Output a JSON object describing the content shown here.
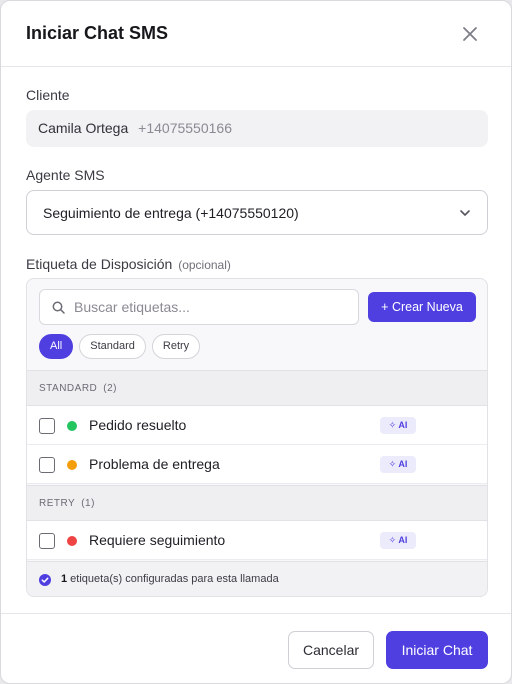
{
  "dialog": {
    "title": "Iniciar Chat SMS"
  },
  "client": {
    "label": "Cliente",
    "name": "Camila Ortega",
    "phone": "+14075550166"
  },
  "agent": {
    "label": "Agente SMS",
    "selected": "Seguimiento de entrega (+14075550120)"
  },
  "disposition": {
    "label": "Etiqueta de Disposición",
    "optional": "(opcional)",
    "search_placeholder": "Buscar etiquetas...",
    "create_label": "+ Crear Nueva",
    "filters": [
      "All",
      "Standard",
      "Retry"
    ],
    "active_filter": "All",
    "sections": [
      {
        "title": "STANDARD",
        "count": "(2)",
        "items": [
          {
            "name": "Pedido resuelto",
            "color": "#22c55e",
            "badge": "AI",
            "checked": false
          },
          {
            "name": "Problema de entrega",
            "color": "#f59e0b",
            "badge": "AI",
            "checked": false
          }
        ]
      },
      {
        "title": "RETRY",
        "count": "(1)",
        "items": [
          {
            "name": "Requiere seguimiento",
            "color": "#ef4444",
            "badge": "AI",
            "checked": false
          }
        ]
      }
    ],
    "summary_count": "1",
    "summary_text": " etiqueta(s) configuradas para esta llamada"
  },
  "actions": {
    "cancel": "Cancelar",
    "start": "Iniciar Chat"
  },
  "colors": {
    "accent": "#4f3fe0"
  },
  "icons": [
    "close-icon",
    "chevron-down-icon",
    "search-icon",
    "sparkle-icon",
    "check-circle-icon"
  ]
}
